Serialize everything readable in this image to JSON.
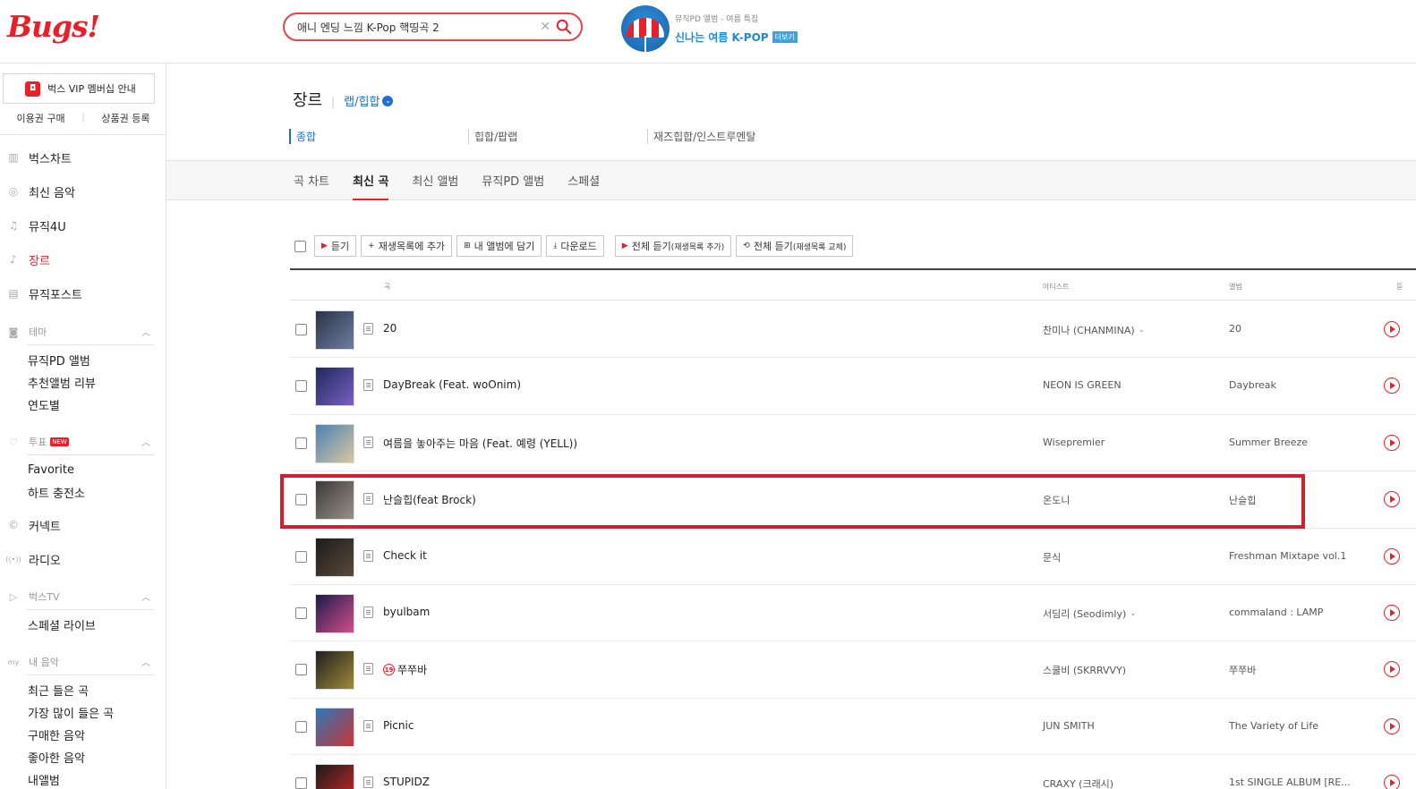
{
  "header": {
    "logo": "Bugs!",
    "search": {
      "value": "애니 엔딩 느낌 K-Pop 핵띵곡 2",
      "clear": "✕"
    },
    "promo": {
      "subtitle": "뮤직PD 앨범 - 여름 특집",
      "title": "신나는 여름 K-POP",
      "more": "더보기"
    }
  },
  "sidebar": {
    "vip": {
      "icon": "◘",
      "label": "벅스 VIP 멤버십 안내"
    },
    "links": [
      "이용권 구매",
      "상품권 등록"
    ],
    "menu_top": [
      {
        "label": "벅스차트",
        "icon": "bar-chart-icon",
        "glyph": "▥"
      },
      {
        "label": "최신 음악",
        "icon": "search-icon",
        "glyph": "◎"
      },
      {
        "label": "뮤직4U",
        "icon": "music-note-icon",
        "glyph": "♫"
      },
      {
        "label": "장르",
        "icon": "guitar-icon",
        "glyph": "♪",
        "active": true
      },
      {
        "label": "뮤직포스트",
        "icon": "post-icon",
        "glyph": "▤"
      }
    ],
    "theme": {
      "label": "테마",
      "items": [
        "뮤직PD 앨범",
        "추천앨범 리뷰",
        "연도별"
      ]
    },
    "vote": {
      "label": "투표",
      "badge": "NEW",
      "items": [
        "Favorite",
        "하트 충전소"
      ]
    },
    "menu_mid": [
      {
        "label": "커넥트",
        "icon": "connect-icon",
        "glyph": "©"
      },
      {
        "label": "라디오",
        "icon": "radio-icon",
        "glyph": "((•))"
      }
    ],
    "bugstv": {
      "label": "벅스TV",
      "items": [
        "스페셜 라이브"
      ]
    },
    "mymusic": {
      "label": "내 음악",
      "items": [
        "최근 들은 곡",
        "가장 많이 들은 곡",
        "구매한 음악",
        "좋아한 음악",
        "내앨범"
      ]
    }
  },
  "main": {
    "title": "장르",
    "genre_selected": "랩/힙합",
    "subgenres": [
      "종합",
      "힙합/팝랩",
      "재즈힙합/인스트루멘탈"
    ],
    "tabs": [
      "곡 차트",
      "최신 곡",
      "최신 앨범",
      "뮤직PD 앨범",
      "스페셜"
    ],
    "active_tab": 1,
    "toolbar": {
      "listen": "듣기",
      "add_playlist": "재생목록에 추가",
      "add_album": "내 앨범에 담기",
      "download": "다운로드",
      "play_all_add": "전체 듣기",
      "play_all_add_sub": "(재생목록 추가)",
      "play_all_replace": "전체 듣기",
      "play_all_replace_sub": "(재생목록 교체)"
    },
    "columns": {
      "song": "곡",
      "artist": "아티스트",
      "album": "앨범",
      "listen": "듣"
    },
    "songs": [
      {
        "title": "20",
        "artist": "찬미나 (CHANMINA)",
        "artist_more": true,
        "album": "20",
        "thumb": [
          "#2b3347",
          "#6d7ea0"
        ]
      },
      {
        "title": "DayBreak (Feat. woOnim)",
        "artist": "NEON IS GREEN",
        "album": "Daybreak",
        "thumb": [
          "#1d2a5c",
          "#7a5fc4"
        ]
      },
      {
        "title": "여름을 놓아주는 마음 (Feat. 예령 (YELL))",
        "artist": "Wisepremier",
        "album": "Summer Breeze",
        "thumb": [
          "#4a82b4",
          "#d9c7a0"
        ]
      },
      {
        "title": "난슬힙(feat Brock)",
        "artist": "온도니",
        "album": "난슬힙",
        "thumb": [
          "#3a3a3a",
          "#9a8f86"
        ]
      },
      {
        "title": "Check it",
        "artist": "문식",
        "album": "Freshman Mixtape vol.1",
        "thumb": [
          "#1b1b1b",
          "#5a4a3a"
        ]
      },
      {
        "title": "byulbam",
        "artist": "서딤리 (Seodimly)",
        "artist_more": true,
        "album": "commaland : LAMP",
        "thumb": [
          "#1e1a4a",
          "#d0508a"
        ]
      },
      {
        "title": "쭈쭈바",
        "age": "19",
        "artist": "스쿨비 (SKRRVVY)",
        "album": "쭈쭈바",
        "thumb": [
          "#1f1f1f",
          "#a08a3a"
        ]
      },
      {
        "title": "Picnic",
        "artist": "JUN SMITH",
        "album": "The Variety of Life",
        "thumb": [
          "#2a78b8",
          "#cc3333"
        ]
      },
      {
        "title": "STUPIDZ",
        "artist": "CRAXY (크래시)",
        "album": "1st SINGLE ALBUM [RE...",
        "thumb": [
          "#1a1a1a",
          "#cc2a2a"
        ]
      }
    ]
  }
}
